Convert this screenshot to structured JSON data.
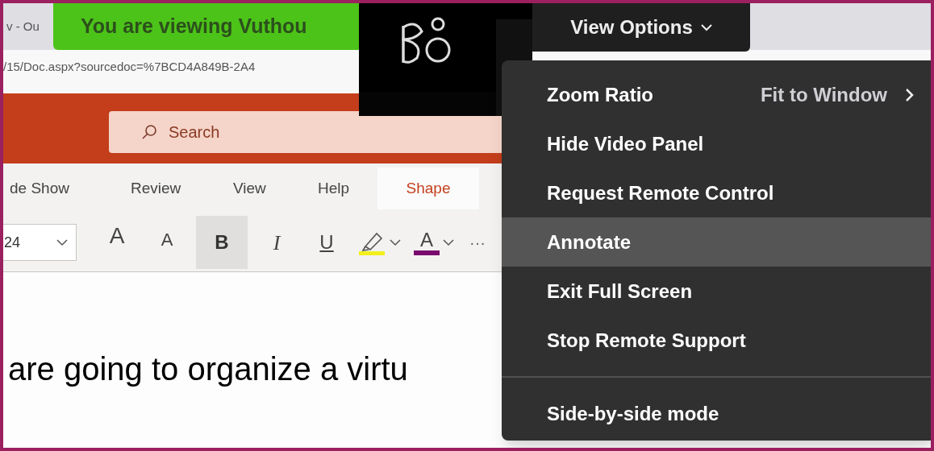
{
  "browser": {
    "tab_title": "v - Ou",
    "url": "/15/Doc.aspx?sourcedoc=%7BCD4A849B-2A4"
  },
  "banner": {
    "text": "You are viewing Vuthou"
  },
  "view_options": {
    "label": "View Options"
  },
  "search": {
    "placeholder": "Search"
  },
  "ribbon_tabs": [
    {
      "label": "de Show",
      "selected": false
    },
    {
      "label": "Review",
      "selected": false
    },
    {
      "label": "View",
      "selected": false
    },
    {
      "label": "Help",
      "selected": false
    },
    {
      "label": "Shape",
      "selected": true
    }
  ],
  "toolbar": {
    "font_size": "24",
    "buttons": [
      {
        "kind": "grow_font",
        "glyph": "A",
        "selected": false
      },
      {
        "kind": "shrink_font",
        "glyph": "A",
        "selected": false
      },
      {
        "kind": "bold",
        "glyph": "B",
        "selected": true
      },
      {
        "kind": "italic",
        "glyph": "I",
        "selected": false
      },
      {
        "kind": "underline",
        "glyph": "U",
        "selected": false
      },
      {
        "kind": "highlight",
        "color": "#f2ef1c",
        "selected": false
      },
      {
        "kind": "font_color",
        "glyph": "A",
        "color": "#7a0a6e",
        "selected": false
      },
      {
        "kind": "more",
        "glyph": "···",
        "selected": false
      }
    ]
  },
  "slide": {
    "text": "are going to organize a virtu"
  },
  "menu": {
    "groups": [
      [
        {
          "label": "Zoom Ratio",
          "value": "Fit to Window",
          "submenu": true,
          "selected": false
        },
        {
          "label": "Hide Video Panel",
          "submenu": false,
          "selected": false
        },
        {
          "label": "Request Remote Control",
          "submenu": false,
          "selected": false
        },
        {
          "label": "Annotate",
          "submenu": false,
          "selected": true
        },
        {
          "label": "Exit Full Screen",
          "submenu": false,
          "selected": false
        },
        {
          "label": "Stop Remote Support",
          "submenu": false,
          "selected": false
        }
      ],
      [
        {
          "label": "Side-by-side mode",
          "submenu": false,
          "selected": false
        }
      ]
    ]
  }
}
